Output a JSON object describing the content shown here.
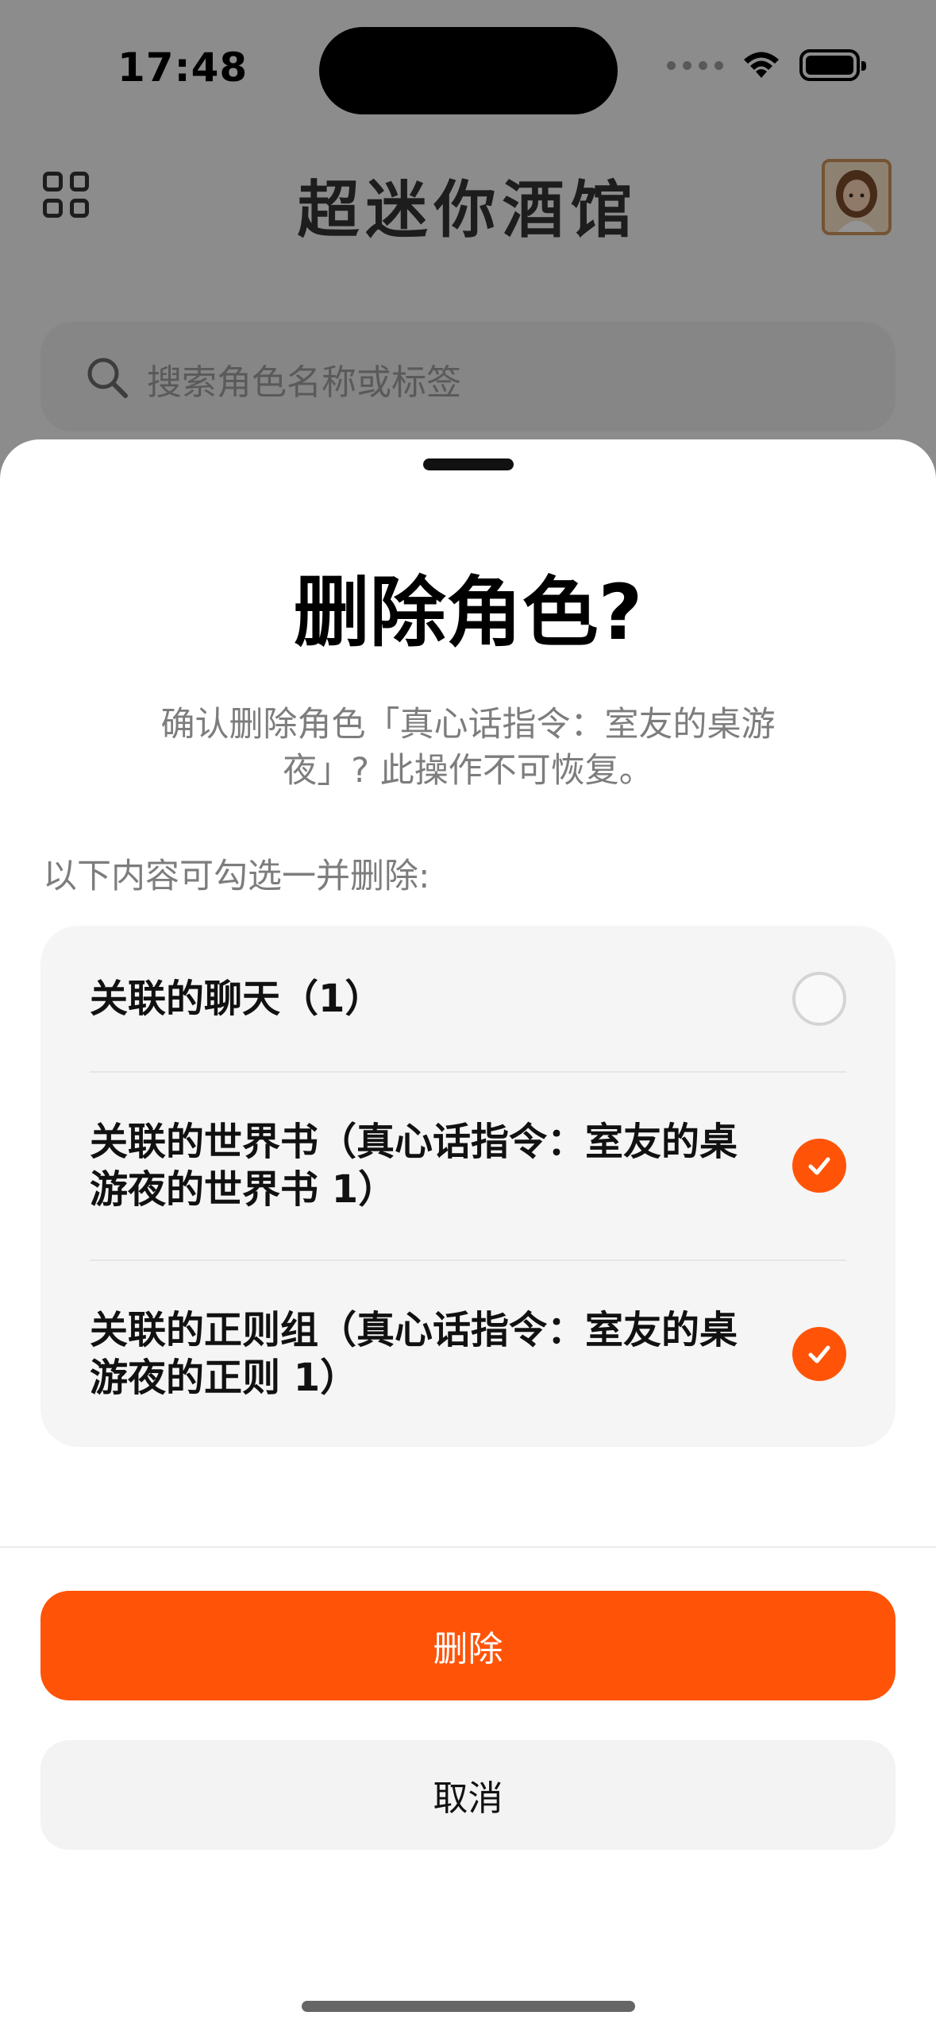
{
  "status_bar": {
    "time": "17:48"
  },
  "app": {
    "title": "超迷你酒馆",
    "search_placeholder": "搜索角色名称或标签"
  },
  "dialog": {
    "title": "删除角色?",
    "message": "确认删除角色「真心话指令：室友的桌游夜」? 此操作不可恢复。",
    "options_hint": "以下内容可勾选一并删除:",
    "options": [
      {
        "label": "关联的聊天（1）",
        "checked": false
      },
      {
        "label": "关联的世界书（真心话指令：室友的桌游夜的世界书 1）",
        "checked": true
      },
      {
        "label": "关联的正则组（真心话指令：室友的桌游夜的正则 1）",
        "checked": true
      }
    ],
    "delete_label": "删除",
    "cancel_label": "取消"
  },
  "colors": {
    "accent": "#ff5408",
    "scrim": "rgba(0,0,0,0.42)",
    "card_bg": "#f5f5f5"
  },
  "icons": {
    "menu": "grid-icon",
    "search": "search-icon",
    "check": "checkmark-icon",
    "wifi": "wifi-icon",
    "battery": "battery-icon"
  }
}
